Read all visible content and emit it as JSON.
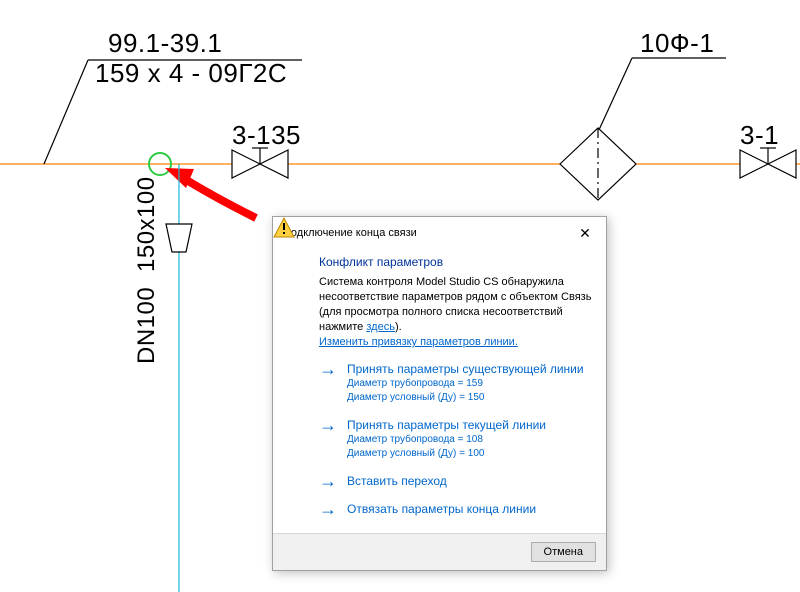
{
  "schematic": {
    "label_top1": "99.1-39.1",
    "label_top2": "159 x 4 - 09Г2С",
    "valve_left_label": "3-135",
    "element_right_label": "10Ф-1",
    "valve_far_right_label": "3-1",
    "vtext_upper": "150x100",
    "vtext_lower": "DN100"
  },
  "dialog": {
    "title": "Подключение конца связи",
    "heading": "Конфликт параметров",
    "desc_prefix": "Система контроля Model Studio CS обнаружила несоответствие параметров рядом с объектом Связь (для просмотра полного списка несоответствий нажмите ",
    "desc_link": "здесь",
    "desc_suffix": ").",
    "change_link": "Изменить привязку параметров линии.",
    "options": [
      {
        "title": "Принять параметры существующей линии",
        "sub1": "Диаметр трубопровода = 159",
        "sub2": "Диаметр условный (Ду) = 150"
      },
      {
        "title": "Принять параметры текущей линии",
        "sub1": "Диаметр трубопровода = 108",
        "sub2": "Диаметр условный (Ду) = 100"
      },
      {
        "title": "Вставить переход"
      },
      {
        "title": "Отвязать параметры конца линии"
      }
    ],
    "cancel": "Отмена"
  }
}
